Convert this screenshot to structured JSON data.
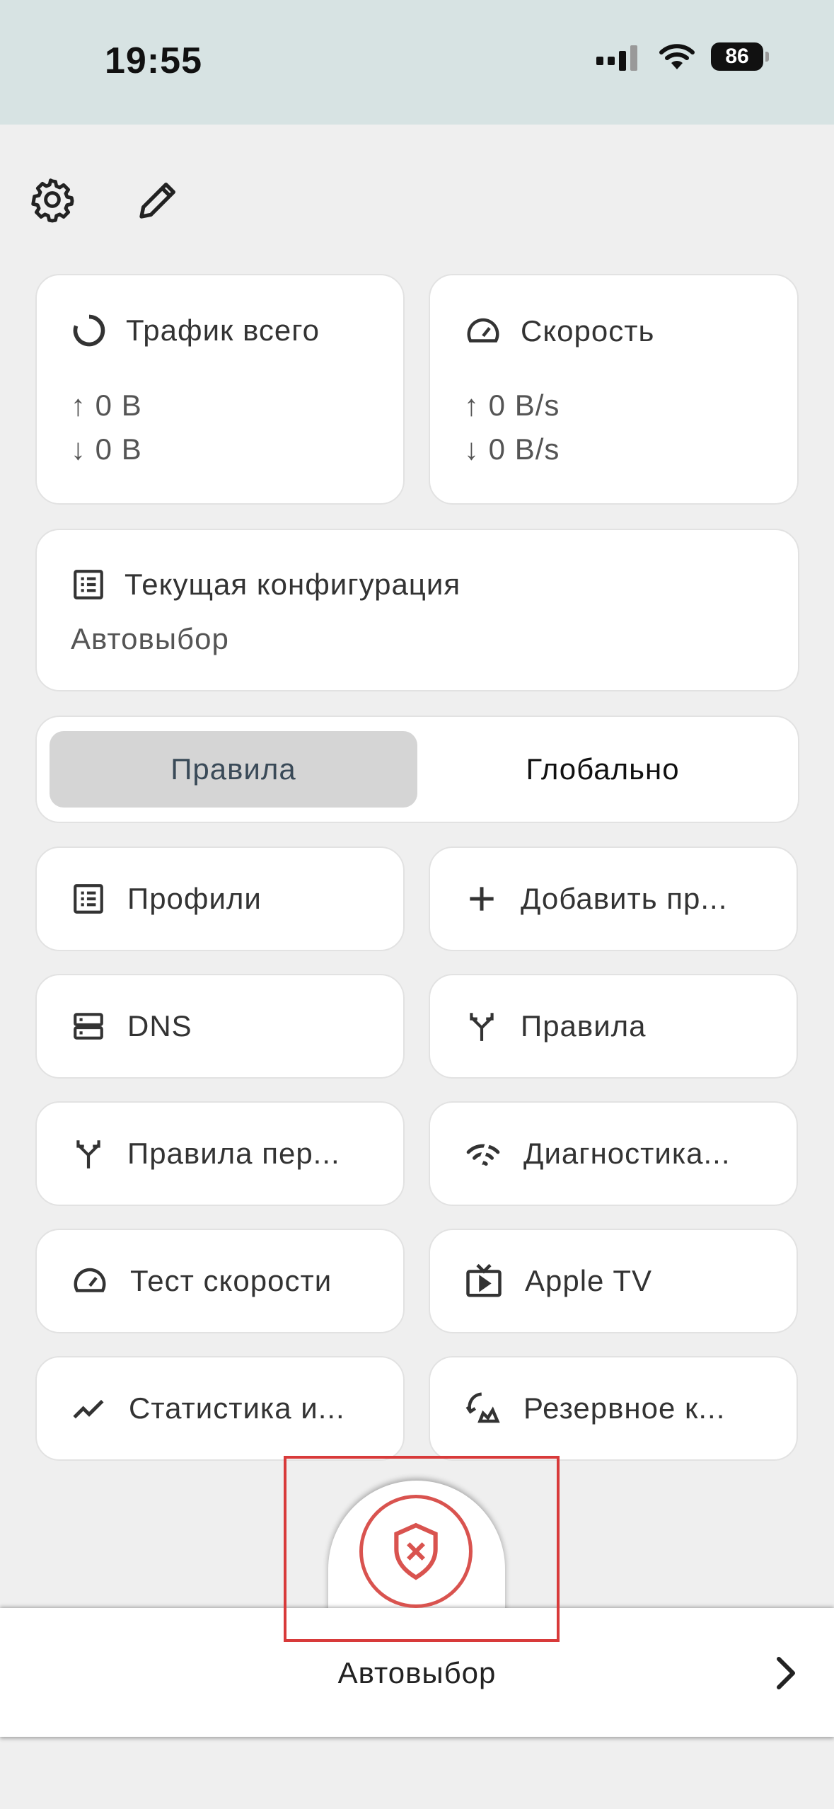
{
  "status_bar": {
    "time": "19:55",
    "battery": "86"
  },
  "header": {
    "settings_icon": "gear-icon",
    "edit_icon": "pencil-icon"
  },
  "traffic_card": {
    "title": "Трафик всего",
    "up": "↑ 0 B",
    "down": "↓ 0 B"
  },
  "speed_card": {
    "title": "Скорость",
    "up": "↑ 0 B/s",
    "down": "↓ 0 B/s"
  },
  "config_card": {
    "title": "Текущая конфигурация",
    "value": "Автовыбор"
  },
  "mode": {
    "rules": "Правила",
    "global": "Глобально",
    "selected": "Правила"
  },
  "tiles": [
    {
      "label": "Профили",
      "icon": "list-icon"
    },
    {
      "label": "Добавить пр...",
      "icon": "plus-icon"
    },
    {
      "label": "DNS",
      "icon": "server-icon"
    },
    {
      "label": "Правила",
      "icon": "fork-icon"
    },
    {
      "label": "Правила пер...",
      "icon": "fork-icon"
    },
    {
      "label": "Диагностика...",
      "icon": "signal-icon"
    },
    {
      "label": "Тест скорости",
      "icon": "speedometer-icon"
    },
    {
      "label": "Apple TV",
      "icon": "tv-icon"
    },
    {
      "label": "Статистика и...",
      "icon": "trend-icon"
    },
    {
      "label": "Резервное к...",
      "icon": "backup-icon"
    }
  ],
  "bottom": {
    "label": "Автовыбор"
  },
  "colors": {
    "background": "#efefef",
    "status_bar": "#d7e3e3",
    "accent_red": "#d9534f",
    "segment_active": "#d5d5d5"
  }
}
